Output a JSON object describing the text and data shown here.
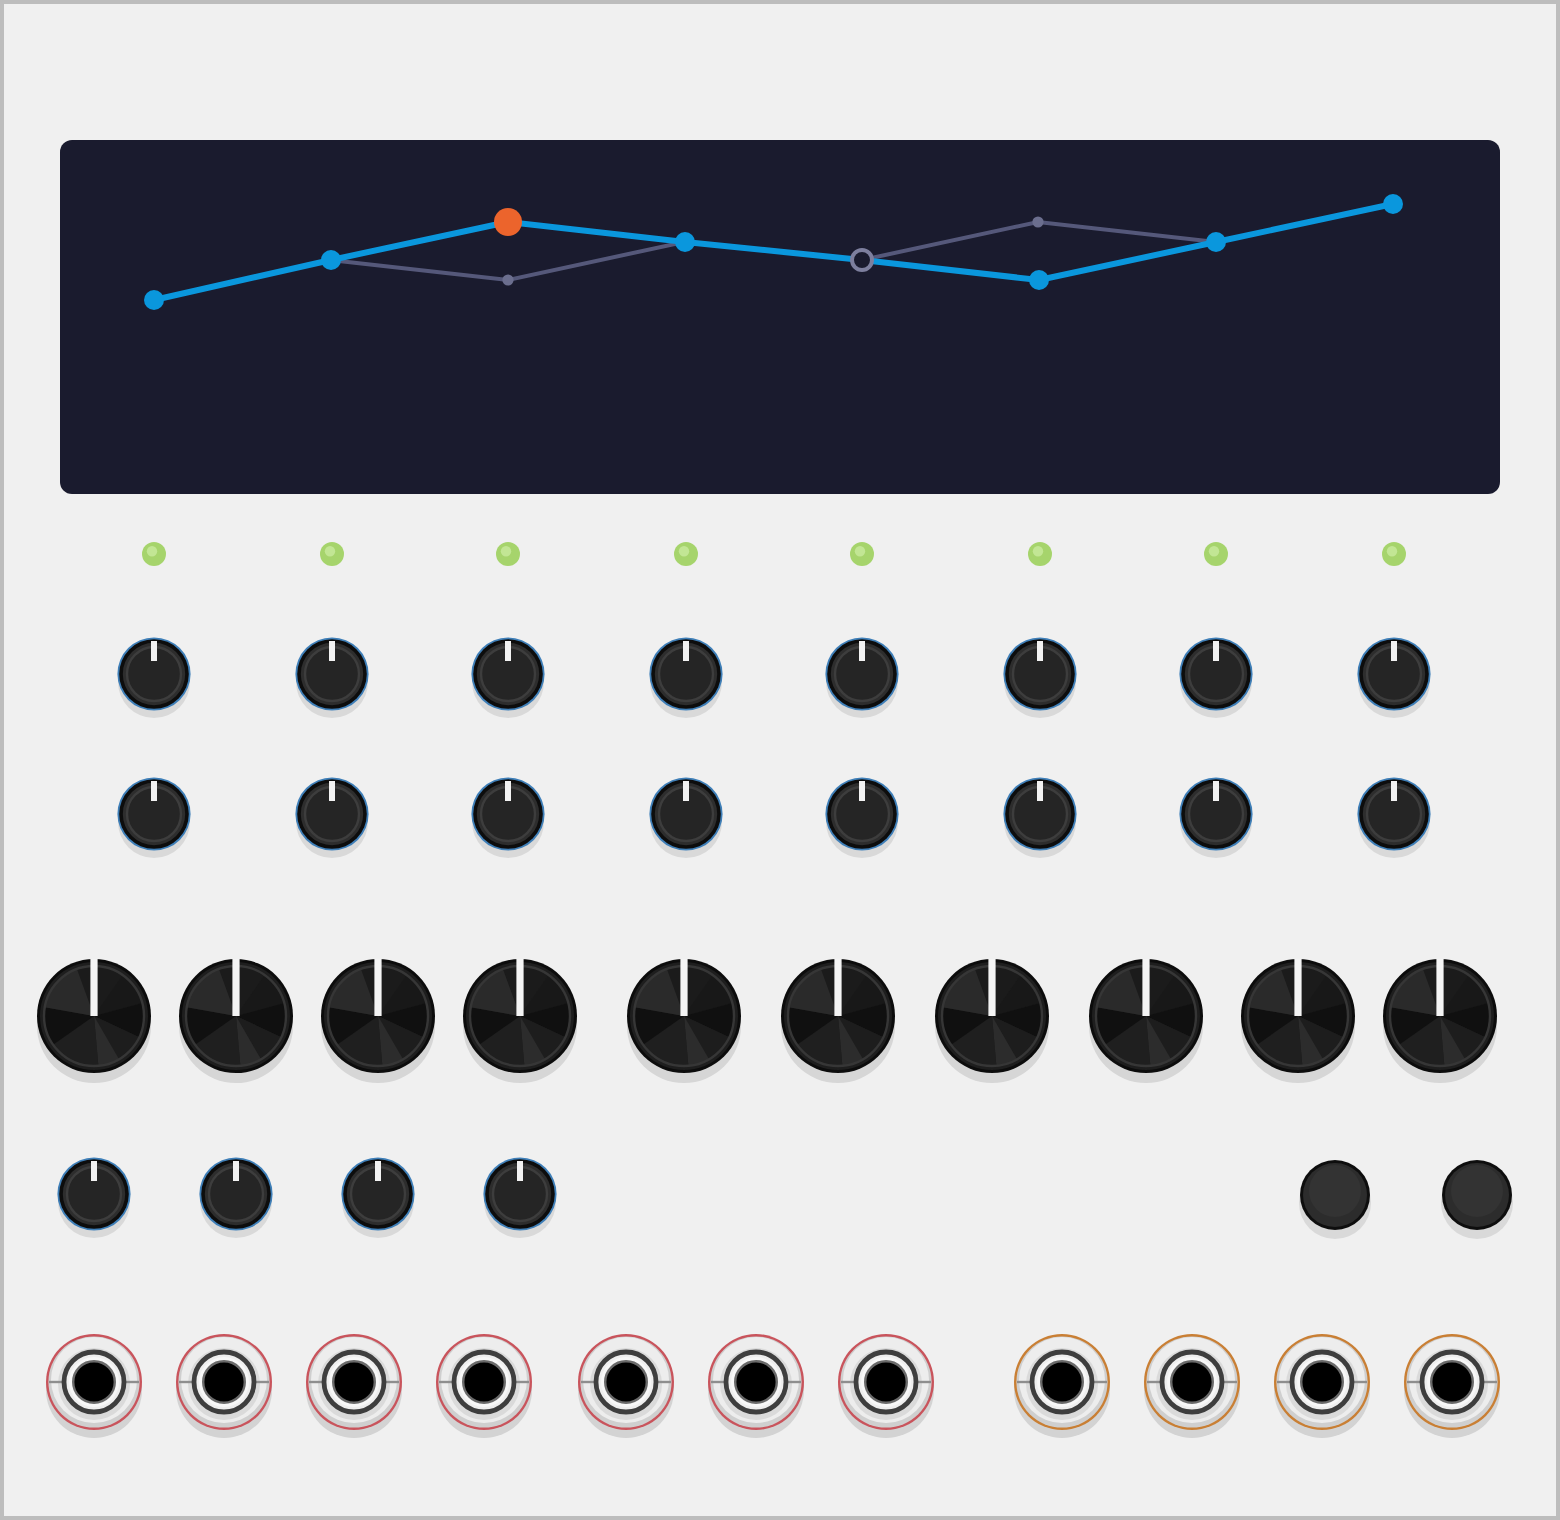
{
  "steps": [
    {
      "on": true,
      "selected": false,
      "playing": false
    },
    {
      "on": true,
      "selected": false,
      "playing": false
    },
    {
      "on": true,
      "selected": true,
      "playing": false
    },
    {
      "on": true,
      "selected": false,
      "playing": false
    },
    {
      "on": true,
      "selected": false,
      "playing": true
    },
    {
      "on": true,
      "selected": false,
      "playing": false
    },
    {
      "on": true,
      "selected": false,
      "playing": false
    },
    {
      "on": true,
      "selected": false,
      "playing": false
    }
  ],
  "knob_rows": [
    {
      "knobs": [
        {
          "level": 0.5
        },
        {
          "level": 0.5
        },
        {
          "level": 0.5
        },
        {
          "level": 0.5
        },
        {
          "level": 0.5
        },
        {
          "level": 0.5
        },
        {
          "level": 0.5
        },
        {
          "level": 0.5
        }
      ]
    },
    {
      "knobs": [
        {
          "level": 0.5
        },
        {
          "level": 0.5
        },
        {
          "level": 0.5
        },
        {
          "level": 0.5
        },
        {
          "level": 0.5
        },
        {
          "level": 0.5
        },
        {
          "level": 0.5
        },
        {
          "level": 0.5
        }
      ]
    }
  ],
  "large_knobs": [
    {
      "level": 0.5
    },
    {
      "level": 0.5
    },
    {
      "level": 0.5
    },
    {
      "level": 0.5
    },
    {
      "level": 0.5
    },
    {
      "level": 0.5
    },
    {
      "level": 0.5
    },
    {
      "level": 0.5
    },
    {
      "level": 0.5
    },
    {
      "level": 0.5
    }
  ],
  "controls": [
    {
      "kind": "knob",
      "level": 0.5
    },
    {
      "kind": "knob",
      "level": 0.5
    },
    {
      "kind": "knob",
      "level": 0.5
    },
    {
      "kind": "knob",
      "level": 0.5
    },
    {
      "kind": "button"
    },
    {
      "kind": "button"
    }
  ],
  "jacks": [
    {
      "color": "#c9545c"
    },
    {
      "color": "#c9545c"
    },
    {
      "color": "#c9545c"
    },
    {
      "color": "#c9545c"
    },
    {
      "color": "#c9545c"
    },
    {
      "color": "#c9545c"
    },
    {
      "color": "#c9545c"
    },
    {
      "color": "#c97f34"
    },
    {
      "color": "#c97f34"
    },
    {
      "color": "#c97f34"
    },
    {
      "color": "#c97f34"
    }
  ]
}
